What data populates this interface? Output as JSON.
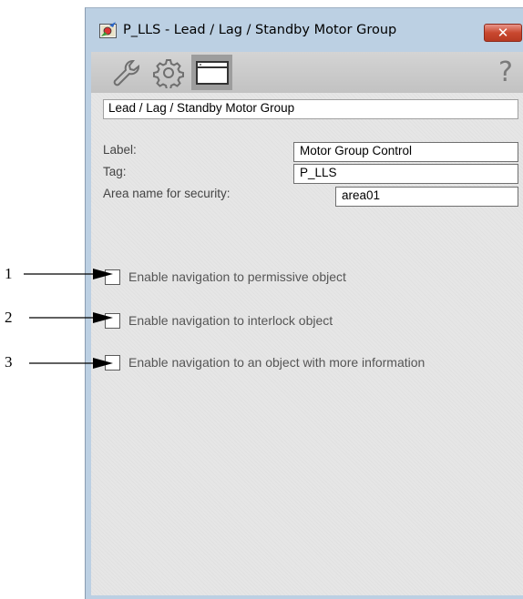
{
  "window": {
    "title": "P_LLS - Lead / Lag / Standby Motor Group",
    "close_symbol": "✕"
  },
  "toolbar": {
    "tabs": [
      {
        "icon": "wrench-icon",
        "selected": false
      },
      {
        "icon": "gear-icon",
        "selected": false
      },
      {
        "icon": "window-icon",
        "selected": true
      }
    ],
    "help_symbol": "?"
  },
  "form": {
    "description": "Lead / Lag / Standby Motor Group",
    "label_caption": "Label:",
    "label_value": "Motor Group Control",
    "tag_caption": "Tag:",
    "tag_value": "P_LLS",
    "area_caption": "Area name for security:",
    "area_value": "area01"
  },
  "options": [
    {
      "label": "Enable navigation to permissive object",
      "checked": false
    },
    {
      "label": "Enable navigation to interlock object",
      "checked": false
    },
    {
      "label": "Enable navigation to an object with more information",
      "checked": false
    }
  ],
  "callouts": [
    "1",
    "2",
    "3"
  ]
}
